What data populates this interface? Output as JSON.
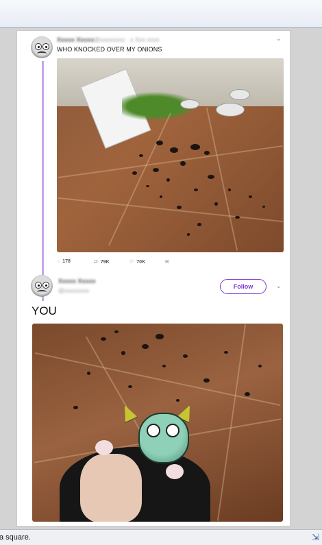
{
  "tweet1": {
    "text": "WHO KNOCKED OVER MY ONIONS",
    "replies": "178",
    "retweets": "79K",
    "likes": "70K"
  },
  "tweet2": {
    "follow_label": "Follow",
    "text": "YOU"
  },
  "statusbar": {
    "text": "a square."
  },
  "icons": [
    "chevron-down-icon",
    "reply-icon",
    "retweet-icon",
    "like-icon",
    "dm-icon",
    "resize-grip-icon"
  ]
}
